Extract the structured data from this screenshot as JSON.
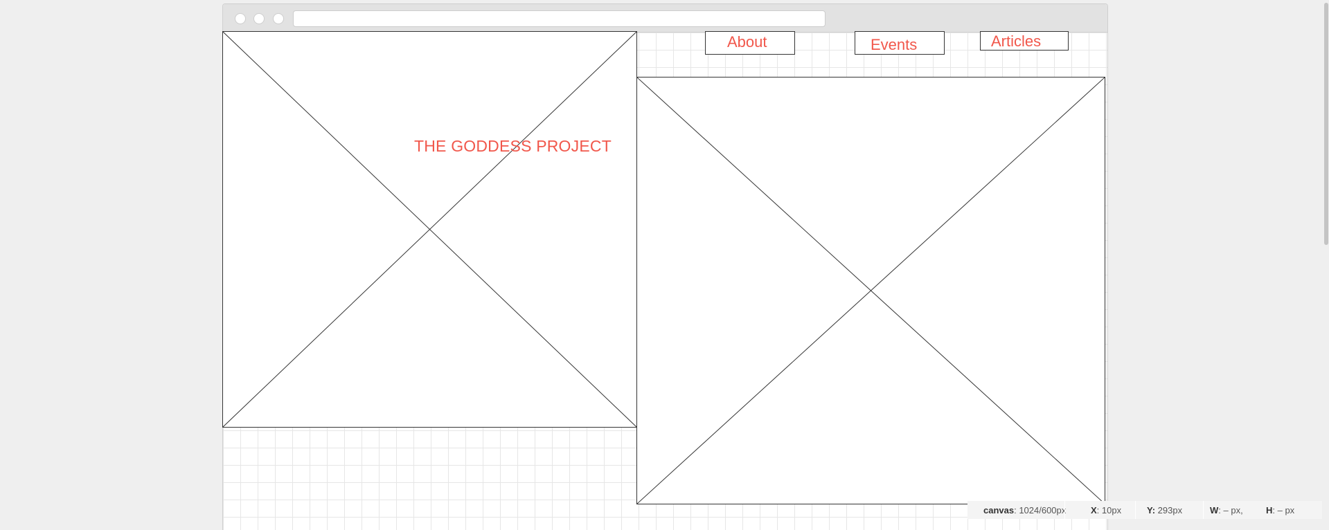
{
  "site": {
    "title": "THE GODDESS PROJECT",
    "nav": [
      {
        "label": "About"
      },
      {
        "label": "Events"
      },
      {
        "label": "Articles"
      }
    ]
  },
  "status": {
    "canvas_label": "canvas",
    "canvas_value": ": 1024/600px",
    "x_label": "X",
    "x_value": ": 10px",
    "y_label": "Y:",
    "y_value": " 293px",
    "w_label": "W",
    "w_value": ": – px,",
    "h_label": "H",
    "h_value": ": – px"
  },
  "colors": {
    "accent_text": "#f1574b",
    "outline": "#333333",
    "grid": "#e6e6e6"
  }
}
